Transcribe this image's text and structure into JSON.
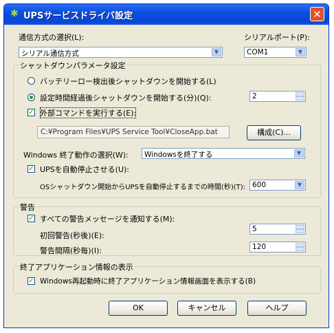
{
  "window": {
    "title": "UPSサービスドライバ設定",
    "close_symbol": "✕",
    "icon": "ups-app-icon"
  },
  "comm": {
    "label": "通信方式の選択(L):",
    "value": "シリアル通信方式",
    "port_label": "シリアルポート(P):",
    "port_value": "COM1"
  },
  "shutdown": {
    "group_title": "シャットダウンパラメータ設定",
    "radio_battery": "バッテリーロー検出後シャットダウンを開始する(L)",
    "radio_timed": "設定時間経過後シャットダウンを開始する(分)(Q):",
    "timed_selected": true,
    "minutes": "2",
    "external_cmd_label": "外部コマンドを実行する(E):",
    "external_cmd_checked": true,
    "command_path": "C:¥Program Files¥UPS Service Tool¥CloseApp.bat",
    "config_button": "構成(C)...",
    "windows_action_label": "Windows 終了動作の選択(W):",
    "windows_action_value": "Windowsを終了する",
    "auto_stop_label": "UPSを自動停止させる(U):",
    "auto_stop_checked": true,
    "auto_stop_time_label": "OSシャットダウン開始からUPSを自動停止するまでの時間(秒)(T):",
    "auto_stop_time_value": "600"
  },
  "warning": {
    "group_title": "警告",
    "notify_all_label": "すべての警告メッセージを通知する(M):",
    "notify_all_checked": true,
    "first_warning_label": "初回警告(秒後)(E):",
    "first_warning_value": "5",
    "interval_label": "警告間隔(秒毎)(I):",
    "interval_value": "120"
  },
  "exit_app": {
    "group_title": "終了アプリケーション情報の表示",
    "label": "Windows再起動時に終了アプリケーション情報画面を表示する(B)",
    "checked": true
  },
  "buttons": {
    "ok": "OK",
    "cancel": "キャンセル",
    "help": "ヘルプ"
  }
}
